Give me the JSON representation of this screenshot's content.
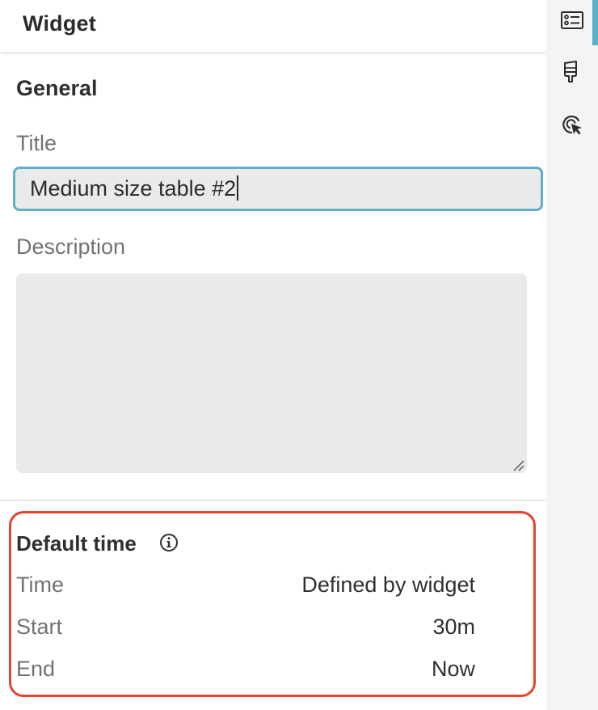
{
  "panel": {
    "title": "Widget"
  },
  "general": {
    "section_title": "General",
    "title_label": "Title",
    "title_value": "Medium size table #2",
    "description_label": "Description",
    "description_value": ""
  },
  "default_time": {
    "section_title": "Default time",
    "rows": [
      {
        "label": "Time",
        "value": "Defined by widget"
      },
      {
        "label": "Start",
        "value": "30m"
      },
      {
        "label": "End",
        "value": "Now"
      }
    ]
  },
  "sidebar": {
    "items": [
      {
        "icon": "general-settings-icon",
        "active": true
      },
      {
        "icon": "paintbrush-icon",
        "active": false
      },
      {
        "icon": "interaction-cursor-icon",
        "active": false
      }
    ]
  },
  "colors": {
    "accent": "#5cb0c9",
    "highlight": "#e5432e",
    "input_bg": "#eaeaea"
  }
}
